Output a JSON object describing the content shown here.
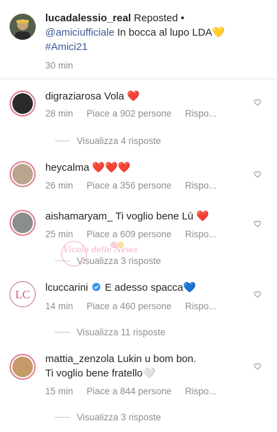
{
  "post": {
    "username": "lucadalessio_real",
    "reposted_label": "Reposted •",
    "mention": "@amiciufficiale",
    "caption": "In bocca al lupo LDA",
    "caption_emoji": "💛",
    "hashtag": "#Amici21",
    "time": "30 min"
  },
  "comments": [
    {
      "username": "digraziarosa",
      "text": "Vola",
      "emoji": "❤️",
      "time": "28 min",
      "likes": "Piace a 902 persone",
      "reply": "Rispo...",
      "view_replies": "Visualizza 4 risposte",
      "avatar_color": "#2b2b2b"
    },
    {
      "username": "heycalma",
      "text": "",
      "emoji": "❤️❤️❤️",
      "time": "26 min",
      "likes": "Piace a 356 persone",
      "reply": "Rispo...",
      "view_replies": "",
      "avatar_color": "#b9a48e"
    },
    {
      "username": "aishamaryam_",
      "text": "Ti voglio bene Lù",
      "emoji": "❤️",
      "time": "25 min",
      "likes": "Piace a 609 persone",
      "reply": "Rispo...",
      "view_replies": "Visualizza 3 risposte",
      "avatar_color": "#8a8f8c"
    },
    {
      "username": "lcuccarini",
      "text": "E adesso spacca",
      "emoji": "💙",
      "time": "14 min",
      "likes": "Piace a 460 persone",
      "reply": "Rispo...",
      "view_replies": "Visualizza 11 risposte",
      "avatar_logo": "LC",
      "avatar_color": "#c46a7a"
    },
    {
      "username": "mattia_zenzola",
      "text": "Lukin u bom bon.",
      "text2": "Ti voglio bene fratello",
      "emoji": "🤍",
      "time": "15 min",
      "likes": "Piace a 844 persone",
      "reply": "Rispo...",
      "view_replies": "Visualizza 3 risposte",
      "avatar_color": "#c79a6a"
    }
  ],
  "watermark_text": "Vicolo delle News",
  "colors": {
    "text": "#262626",
    "muted": "#8e8e8e",
    "link": "#3b5a99",
    "story_ring": "#e07c8c",
    "heart_red": "#d3132b"
  },
  "icons": {
    "heart": "heart-outline-icon",
    "verified": "verified-badge-icon"
  }
}
